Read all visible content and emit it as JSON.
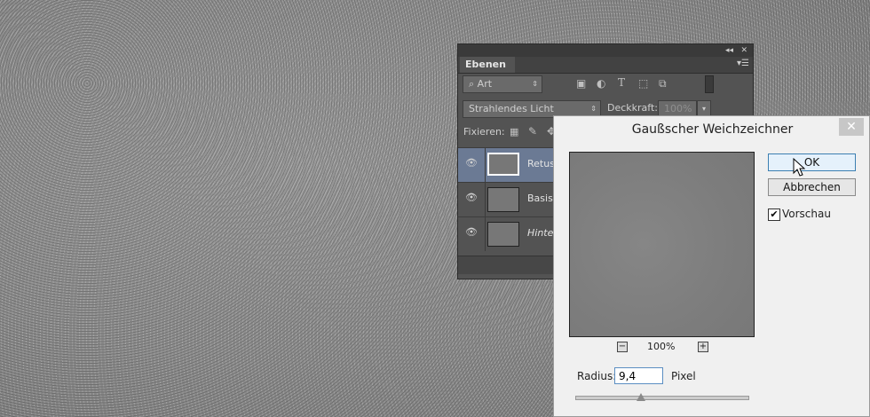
{
  "layers_panel": {
    "tab_label": "Ebenen",
    "search_value": "Art",
    "blend_mode": "Strahlendes Licht",
    "opacity_label": "Deckkraft:",
    "opacity_value": "100%",
    "lock_label": "Fixieren:",
    "layers": [
      {
        "name": "Retus",
        "selected": true
      },
      {
        "name": "Basis",
        "selected": false
      },
      {
        "name": "Hinter",
        "selected": false
      }
    ]
  },
  "dialog": {
    "title": "Gaußscher Weichzeichner",
    "ok_label": "OK",
    "cancel_label": "Abbrechen",
    "preview_label": "Vorschau",
    "preview_checked": true,
    "zoom_value": "100%",
    "zoom_minus": "−",
    "zoom_plus": "+",
    "radius_label": "Radius:",
    "radius_value": "9,4",
    "unit_label": "Pixel",
    "slider_position_fraction": 0.38
  },
  "icons": [
    "search-icon",
    "image-filter-icon",
    "adjustment-filter-icon",
    "type-filter-icon",
    "shape-filter-icon",
    "smart-object-filter-icon",
    "toggle-filter-icon",
    "eye-icon",
    "lock-icon",
    "brush-lock-icon",
    "move-lock-icon",
    "close-icon",
    "collapse-icon",
    "panel-menu-icon",
    "zoom-out-icon",
    "zoom-in-icon",
    "mouse-cursor-icon"
  ]
}
